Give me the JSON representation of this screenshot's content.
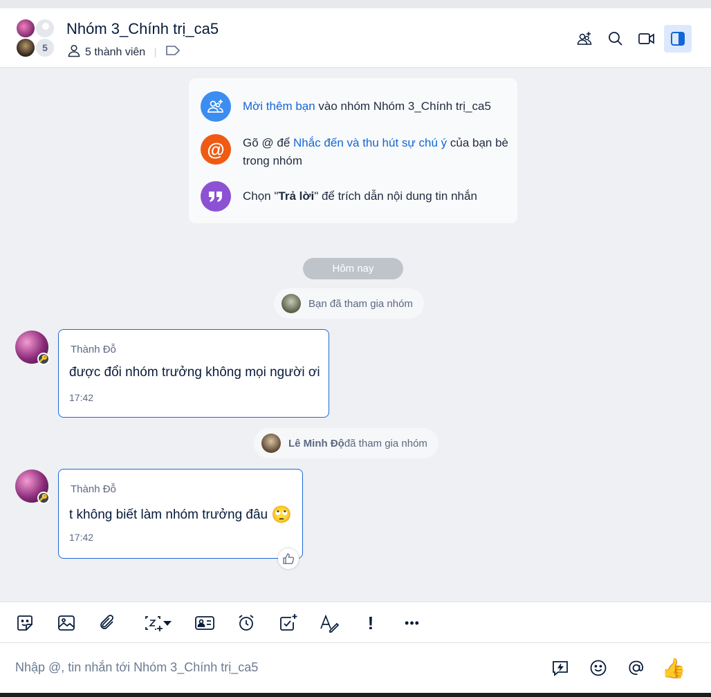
{
  "header": {
    "title": "Nhóm 3_Chính trị_ca5",
    "members": "5 thành viên",
    "avatar_count": "5"
  },
  "tips": {
    "invite_link": "Mời thêm bạn",
    "invite_rest": " vào nhóm Nhóm 3_Chính trị_ca5",
    "mention_prefix": "Gõ @ để ",
    "mention_link": "Nhắc đến và thu hút sự chú ý",
    "mention_rest": " của bạn bè trong nhóm",
    "reply_prefix": "Chọn \"",
    "reply_bold": "Trả lời",
    "reply_rest": "\" để trích dẫn nội dung tin nhắn"
  },
  "day_separator": "Hôm nay",
  "system": {
    "you_joined": "Bạn đã tham gia nhóm",
    "member_name": "Lê Minh Độ",
    "member_joined": " đã tham gia nhóm"
  },
  "messages": [
    {
      "sender": "Thành Đỗ",
      "text": "được đổi nhóm trưởng không mọi người ơi",
      "time": "17:42"
    },
    {
      "sender": "Thành Đỗ",
      "text": "t không biết làm nhóm trưởng đâu",
      "time": "17:42",
      "emoji": "🙄"
    }
  ],
  "composer": {
    "placeholder": "Nhập @, tin nhắn tới Nhóm 3_Chính trị_ca5",
    "like": "👍"
  },
  "toolbar": {
    "more": "•••",
    "important": "!"
  },
  "colors": {
    "accent": "#1266d6",
    "invite_icon": "#3b8df0",
    "mention_icon": "#ef5b13",
    "reply_icon": "#8c52d4"
  }
}
